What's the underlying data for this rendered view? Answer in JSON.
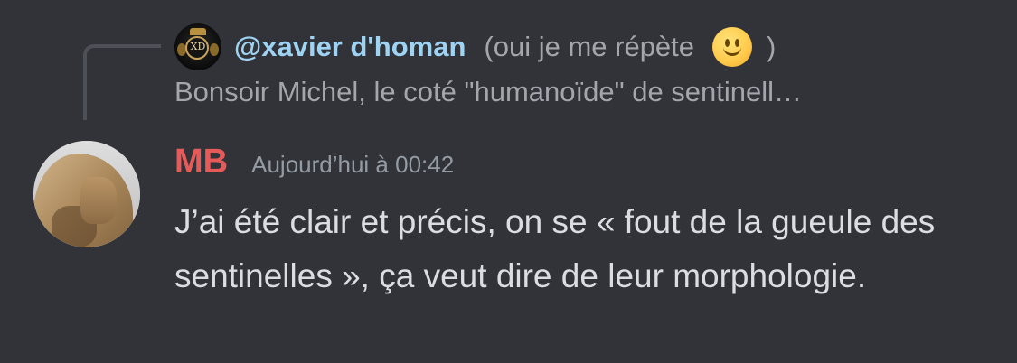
{
  "reply": {
    "author": "@xavier d'homan",
    "note_open": "(oui je me répète",
    "note_close": ")",
    "emoji_name": "slightly-smiling-face",
    "avatar_monogram": "XD",
    "preview": "Bonsoir Michel, le coté \"humanoïde\" de sentinell…"
  },
  "message": {
    "author": "MB",
    "timestamp": "Aujourd’hui à 00:42",
    "body": "J’ai été clair et précis, on se « fout de la gueule des sentinelles », ça veut dire de leur morphologie."
  },
  "colors": {
    "background": "#313338",
    "reply_author": "#9fd3f3",
    "message_author": "#e65a5a",
    "muted_text": "#a4a6ad",
    "timestamp": "#949ba4",
    "body_text": "#dbdee1"
  }
}
